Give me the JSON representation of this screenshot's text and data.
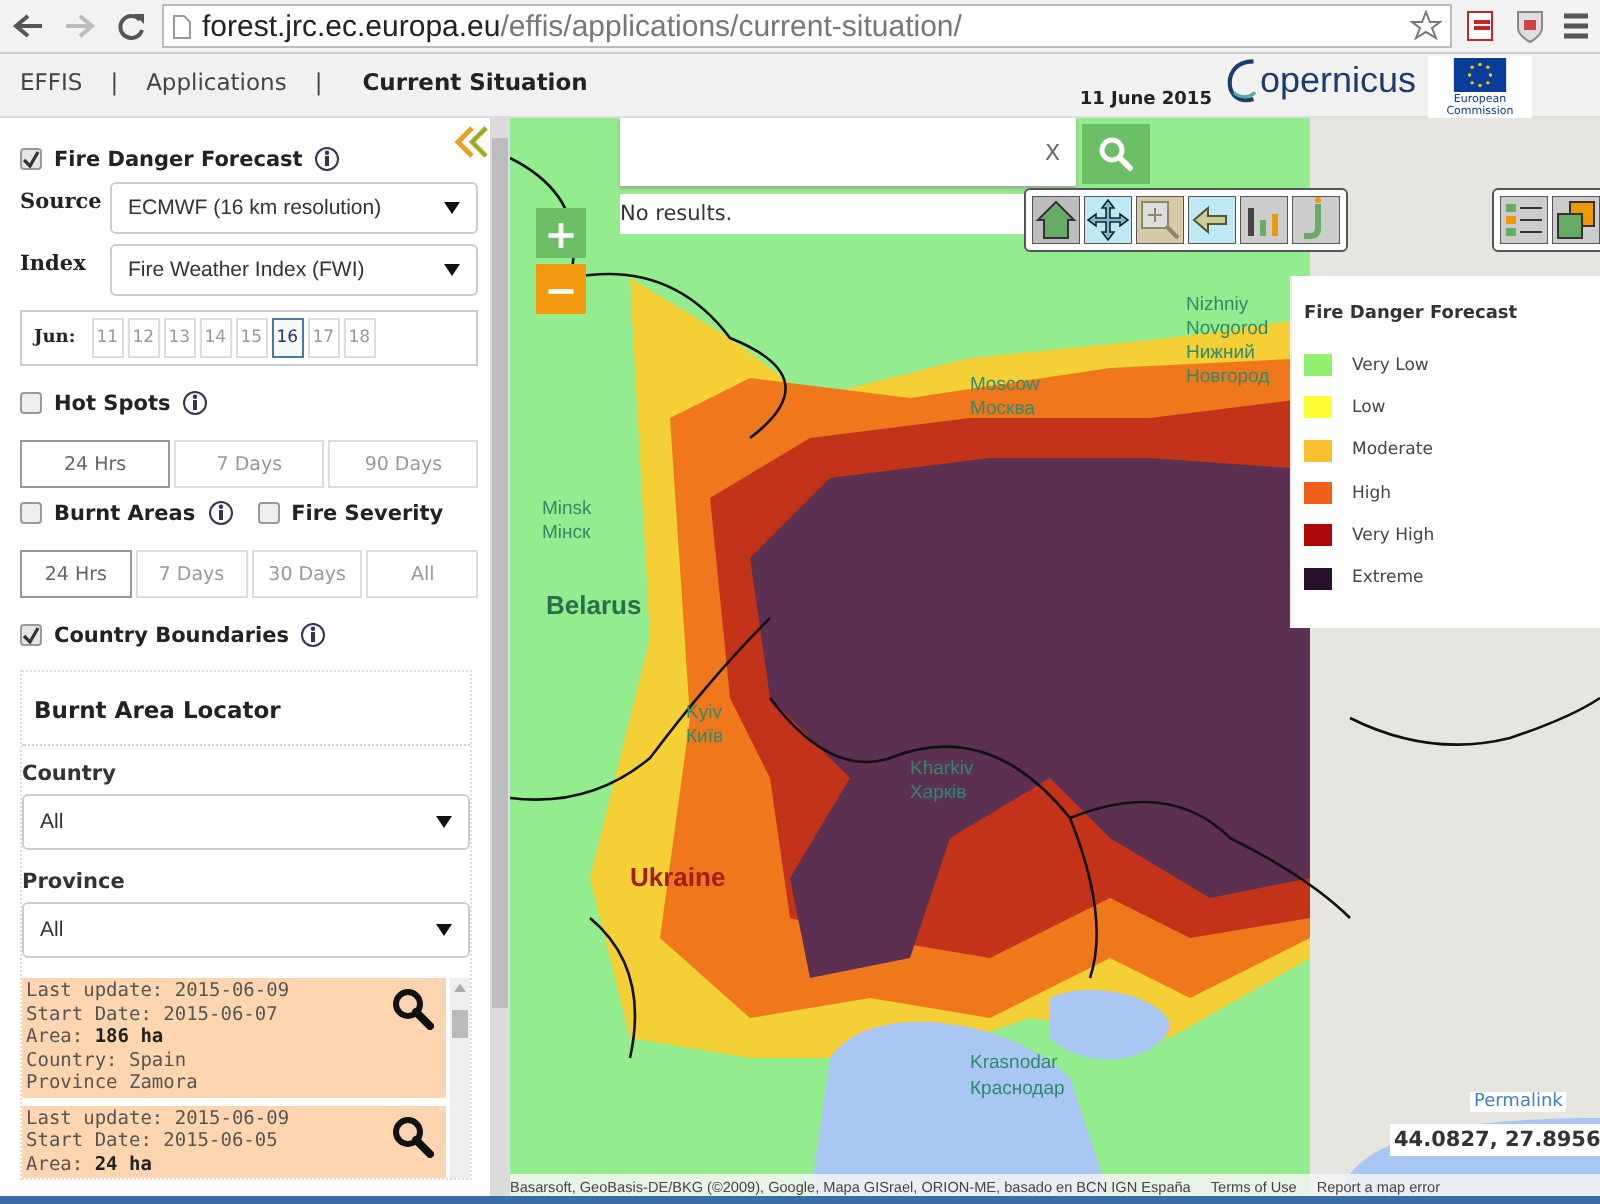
{
  "browser": {
    "url_host": "forest.jrc.ec.europa.eu",
    "url_path": "/effis/applications/current-situation/"
  },
  "nav": [
    {
      "label": "EFFIS",
      "selected": false
    },
    {
      "label": "Applications",
      "selected": false
    },
    {
      "label": "Current Situation",
      "selected": true
    }
  ],
  "separators": [
    "|",
    "|"
  ],
  "header": {
    "date": "11 June 2015",
    "logo_text": "opernicus",
    "eu_label": "European Commission"
  },
  "sidebar": {
    "fire_danger": {
      "label": "Fire Danger Forecast",
      "checked": true
    },
    "source": {
      "label": "Source",
      "value": "ECMWF (16 km resolution)"
    },
    "index": {
      "label": "Index",
      "value": "Fire Weather Index (FWI)"
    },
    "dates": {
      "month": "Jun:",
      "days": [
        {
          "label": "11",
          "selected": false
        },
        {
          "label": "12",
          "selected": false
        },
        {
          "label": "13",
          "selected": false
        },
        {
          "label": "14",
          "selected": false
        },
        {
          "label": "15",
          "selected": false
        },
        {
          "label": "16",
          "selected": true
        },
        {
          "label": "17",
          "selected": false
        },
        {
          "label": "18",
          "selected": false
        }
      ]
    },
    "hot_spots": {
      "label": "Hot Spots",
      "checked": false,
      "periods": [
        {
          "label": "24 Hrs",
          "selected": true
        },
        {
          "label": "7 Days",
          "selected": false
        },
        {
          "label": "90 Days",
          "selected": false
        }
      ]
    },
    "burnt_areas": {
      "label": "Burnt Areas",
      "checked": false,
      "periods": [
        {
          "label": "24 Hrs",
          "selected": true
        },
        {
          "label": "7 Days",
          "selected": false
        },
        {
          "label": "30 Days",
          "selected": false
        },
        {
          "label": "All",
          "selected": false
        }
      ]
    },
    "fire_severity": {
      "label": "Fire Severity",
      "checked": false
    },
    "country_boundaries": {
      "label": "Country Boundaries",
      "checked": true
    },
    "locator": {
      "title": "Burnt Area Locator",
      "country": {
        "label": "Country",
        "value": "All"
      },
      "province": {
        "label": "Province",
        "value": "All"
      },
      "results": [
        {
          "lines": [
            "Last update: 2015-06-09",
            "Start Date: 2015-06-07",
            "Area: **186 ha**",
            "Country: Spain",
            "Province Zamora"
          ]
        },
        {
          "lines": [
            "Last update: 2015-06-09",
            "Start Date: 2015-06-05",
            "Area: **24 ha**"
          ]
        }
      ]
    }
  },
  "map": {
    "search": {
      "clear": "X",
      "message": "No results."
    },
    "zoom": {
      "in": "+",
      "out": "−"
    },
    "legend": {
      "title": "Fire Danger Forecast",
      "items": [
        {
          "label": "Very Low",
          "color": "#90f070"
        },
        {
          "label": "Low",
          "color": "#ffff33"
        },
        {
          "label": "Moderate",
          "color": "#f8c030"
        },
        {
          "label": "High",
          "color": "#f06018"
        },
        {
          "label": "Very High",
          "color": "#b00808"
        },
        {
          "label": "Extreme",
          "color": "#28102a"
        }
      ]
    },
    "labels": [
      {
        "text": "Nizhniy",
        "kind": "city"
      },
      {
        "text": "Novgorod",
        "kind": "city"
      },
      {
        "text": "Нижний",
        "kind": "city"
      },
      {
        "text": "Новгород",
        "kind": "city"
      },
      {
        "text": "Moscow",
        "kind": "city"
      },
      {
        "text": "Москва",
        "kind": "city"
      },
      {
        "text": "Minsk",
        "kind": "city"
      },
      {
        "text": "Мінск",
        "kind": "city"
      },
      {
        "text": "Belarus",
        "kind": "country"
      },
      {
        "text": "Kyiv",
        "kind": "city"
      },
      {
        "text": "Київ",
        "kind": "city"
      },
      {
        "text": "Kharkiv",
        "kind": "city"
      },
      {
        "text": "Харків",
        "kind": "city"
      },
      {
        "text": "Ukraine",
        "kind": "country"
      },
      {
        "text": "Krasnodar",
        "kind": "city"
      },
      {
        "text": "Краснодар",
        "kind": "city"
      }
    ],
    "permalink": "Permalink",
    "coordinates": "44.0827, 27.8956",
    "attribution": "Basarsoft, GeoBasis-DE/BKG (©2009), Google, Mapa GISrael, ORION-ME, basado en BCN IGN España",
    "terms": "Terms of Use",
    "report": "Report a map error"
  }
}
